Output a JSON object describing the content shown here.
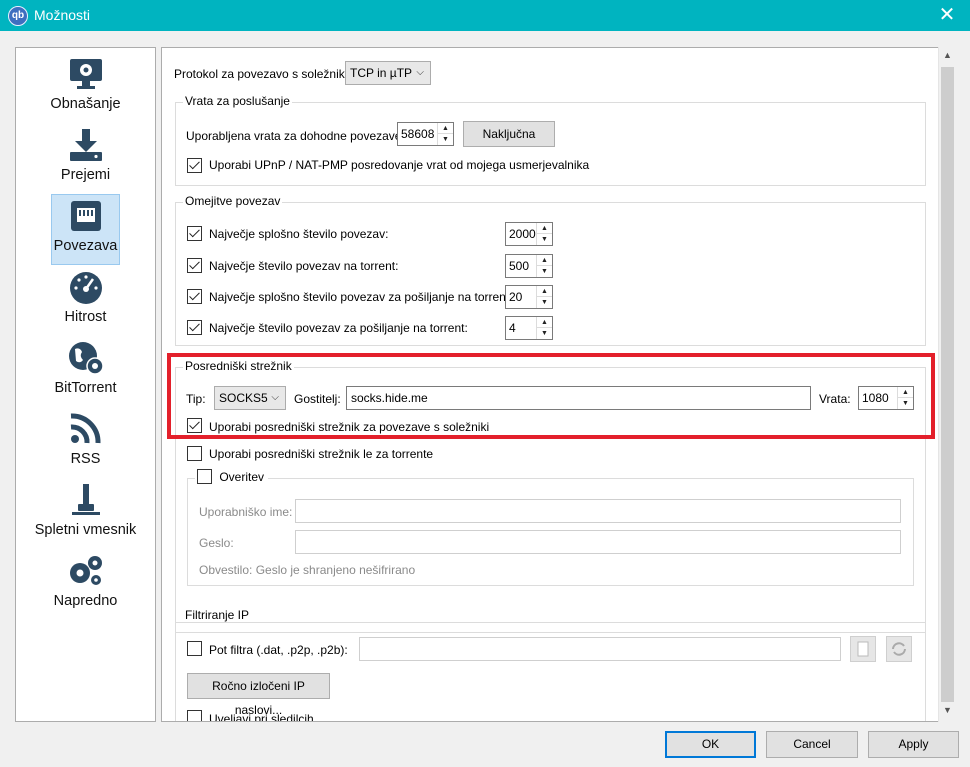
{
  "window": {
    "title": "Možnosti",
    "app_icon_text": "qb",
    "close_glyph": "✕"
  },
  "sidebar": {
    "items": [
      {
        "label": "Obnašanje",
        "icon": "monitor-gear-icon"
      },
      {
        "label": "Prejemi",
        "icon": "download-icon"
      },
      {
        "label": "Povezava",
        "icon": "network-icon"
      },
      {
        "label": "Hitrost",
        "icon": "speedometer-icon"
      },
      {
        "label": "BitTorrent",
        "icon": "globe-gear-icon"
      },
      {
        "label": "RSS",
        "icon": "rss-icon"
      },
      {
        "label": "Spletni vmesnik",
        "icon": "web-ui-icon"
      },
      {
        "label": "Napredno",
        "icon": "gears-icon"
      }
    ],
    "active": "Povezava"
  },
  "protocol": {
    "label": "Protokol za povezavo s soležniki:",
    "value": "TCP in µTP"
  },
  "listening_port": {
    "group_title": "Vrata za poslušanje",
    "port_label": "Uporabljena vrata za dohodne povezave:",
    "port_value": "58608",
    "random_button": "Naključna",
    "upnp_label": "Uporabi UPnP / NAT-PMP posredovanje vrat od mojega usmerjevalnika",
    "upnp_checked": true
  },
  "connection_limits": {
    "group_title": "Omejitve povezav",
    "rows": [
      {
        "label": "Največje splošno število povezav:",
        "value": "2000",
        "checked": true
      },
      {
        "label": "Največje število povezav na torrent:",
        "value": "500",
        "checked": true
      },
      {
        "label": "Največje splošno število povezav za pošiljanje na torrent:",
        "value": "20",
        "checked": true
      },
      {
        "label": "Največje število povezav za pošiljanje na torrent:",
        "value": "4",
        "checked": true
      }
    ]
  },
  "proxy": {
    "group_title": "Posredniški strežnik",
    "type_label": "Tip:",
    "type_value": "SOCKS5",
    "host_label": "Gostitelj:",
    "host_value": "socks.hide.me",
    "port_label": "Vrata:",
    "port_value": "1080",
    "use_for_peers_label": "Uporabi posredniški strežnik za povezave s soležniki",
    "use_for_peers_checked": true,
    "torrents_only_label": "Uporabi posredniški strežnik le za torrente",
    "torrents_only_checked": false,
    "auth": {
      "title": "Overitev",
      "checked": false,
      "username_label": "Uporabniško ime:",
      "password_label": "Geslo:",
      "notice": "Obvestilo: Geslo je shranjeno nešifrirano"
    }
  },
  "ip_filter": {
    "group_title": "Filtriranje IP",
    "filter_path_label": "Pot filtra (.dat, .p2p, .p2b):",
    "filter_path_checked": false,
    "manual_button": "Ročno izločeni IP naslovi...",
    "trackers_label": "Uveljavi pri sledilcih",
    "trackers_checked": false
  },
  "footer": {
    "ok": "OK",
    "cancel": "Cancel",
    "apply": "Apply"
  },
  "colors": {
    "titlebar": "#00b4c0",
    "highlight_box": "#e3202b",
    "selection": "#cce4f7",
    "default_button_border": "#0078d7"
  }
}
